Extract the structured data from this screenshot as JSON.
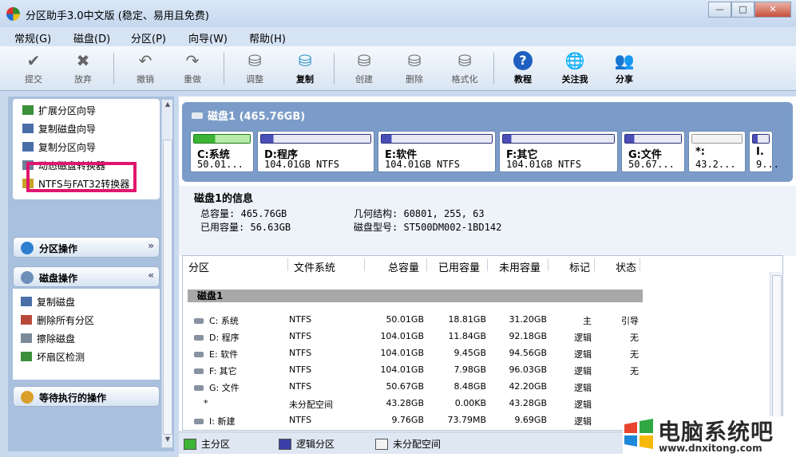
{
  "window": {
    "title": "分区助手3.0中文版 (稳定、易用且免费)",
    "min": "—",
    "max": "□",
    "close": "✕"
  },
  "menu": [
    "常规(G)",
    "磁盘(D)",
    "分区(P)",
    "向导(W)",
    "帮助(H)"
  ],
  "toolbar": [
    {
      "label": "提交",
      "icon": "check-icon"
    },
    {
      "label": "放弃",
      "icon": "x-icon"
    },
    {
      "label": "撤销",
      "icon": "undo-icon"
    },
    {
      "label": "重做",
      "icon": "redo-icon"
    },
    {
      "label": "调整",
      "icon": "resize-disk-icon"
    },
    {
      "label": "复制",
      "icon": "copy-disk-icon"
    },
    {
      "label": "创建",
      "icon": "create-disk-icon"
    },
    {
      "label": "删除",
      "icon": "delete-disk-icon"
    },
    {
      "label": "格式化",
      "icon": "format-disk-icon"
    },
    {
      "label": "教程",
      "icon": "help-icon"
    },
    {
      "label": "关注我",
      "icon": "globe-icon"
    },
    {
      "label": "分享",
      "icon": "users-icon"
    }
  ],
  "sidebar": {
    "wizards": [
      "扩展分区向导",
      "复制磁盘向导",
      "复制分区向导",
      "动态磁盘转换器",
      "NTFS与FAT32转换器"
    ],
    "partition_ops_title": "分区操作",
    "disk_ops_title": "磁盘操作",
    "disk_ops": [
      "复制磁盘",
      "删除所有分区",
      "擦除磁盘",
      "坏扇区检测"
    ],
    "pending_title": "等待执行的操作"
  },
  "disk_strip": {
    "title": "磁盘1 (465.76GB)",
    "partitions": [
      {
        "name": "C:系统",
        "size": "50.01...",
        "used": 0.376,
        "color": "#3cb534",
        "border": "#1f7a1a"
      },
      {
        "name": "D:程序",
        "size": "104.01GB NTFS",
        "used": 0.114,
        "color": "#3a3fa8",
        "border": "#2a2e7a"
      },
      {
        "name": "E:软件",
        "size": "104.01GB NTFS",
        "used": 0.091,
        "color": "#3a3fa8",
        "border": "#2a2e7a"
      },
      {
        "name": "F:其它",
        "size": "104.01GB NTFS",
        "used": 0.077,
        "color": "#3a3fa8",
        "border": "#2a2e7a"
      },
      {
        "name": "G:文件",
        "size": "50.67...",
        "used": 0.167,
        "color": "#3a3fa8",
        "border": "#2a2e7a"
      },
      {
        "name": "*:",
        "size": "43.2...",
        "used": 0,
        "color": "#f3f3f3",
        "border": "#999"
      },
      {
        "name": "I.",
        "size": "9...",
        "used": 0.3,
        "color": "#3a3fa8",
        "border": "#2a2e7a"
      }
    ]
  },
  "disk_info": {
    "title": "磁盘1的信息",
    "total_label": "总容量:",
    "total": "465.76GB",
    "used_label": "已用容量:",
    "used": "56.63GB",
    "geo_label": "几何结构:",
    "geo": "60801, 255, 63",
    "model_label": "磁盘型号:",
    "model": "ST500DM002-1BD142"
  },
  "table": {
    "headers": [
      "分区",
      "文件系统",
      "总容量",
      "已用容量",
      "未用容量",
      "标记",
      "状态"
    ],
    "group": "磁盘1",
    "rows": [
      {
        "name": "C: 系统",
        "fs": "NTFS",
        "total": "50.01GB",
        "used": "18.81GB",
        "free": "31.20GB",
        "flag": "主",
        "status": "引导"
      },
      {
        "name": "D: 程序",
        "fs": "NTFS",
        "total": "104.01GB",
        "used": "11.84GB",
        "free": "92.18GB",
        "flag": "逻辑",
        "status": "无"
      },
      {
        "name": "E: 软件",
        "fs": "NTFS",
        "total": "104.01GB",
        "used": "9.45GB",
        "free": "94.56GB",
        "flag": "逻辑",
        "status": "无"
      },
      {
        "name": "F: 其它",
        "fs": "NTFS",
        "total": "104.01GB",
        "used": "7.98GB",
        "free": "96.03GB",
        "flag": "逻辑",
        "status": "无"
      },
      {
        "name": "G: 文件",
        "fs": "NTFS",
        "total": "50.67GB",
        "used": "8.48GB",
        "free": "42.20GB",
        "flag": "逻辑",
        "status": ""
      },
      {
        "name": "*",
        "fs": "未分配空间",
        "total": "43.28GB",
        "used": "0.00KB",
        "free": "43.28GB",
        "flag": "逻辑",
        "status": ""
      },
      {
        "name": "I: 新建",
        "fs": "NTFS",
        "total": "9.76GB",
        "used": "73.79MB",
        "free": "9.69GB",
        "flag": "逻辑",
        "status": ""
      }
    ]
  },
  "legend": [
    {
      "label": "主分区",
      "color": "#3cb534"
    },
    {
      "label": "逻辑分区",
      "color": "#3a3fa8"
    },
    {
      "label": "未分配空间",
      "color": "#f3f3f3"
    }
  ],
  "watermark": {
    "name": "电脑系统吧",
    "url": "www.dnxitong.com"
  }
}
